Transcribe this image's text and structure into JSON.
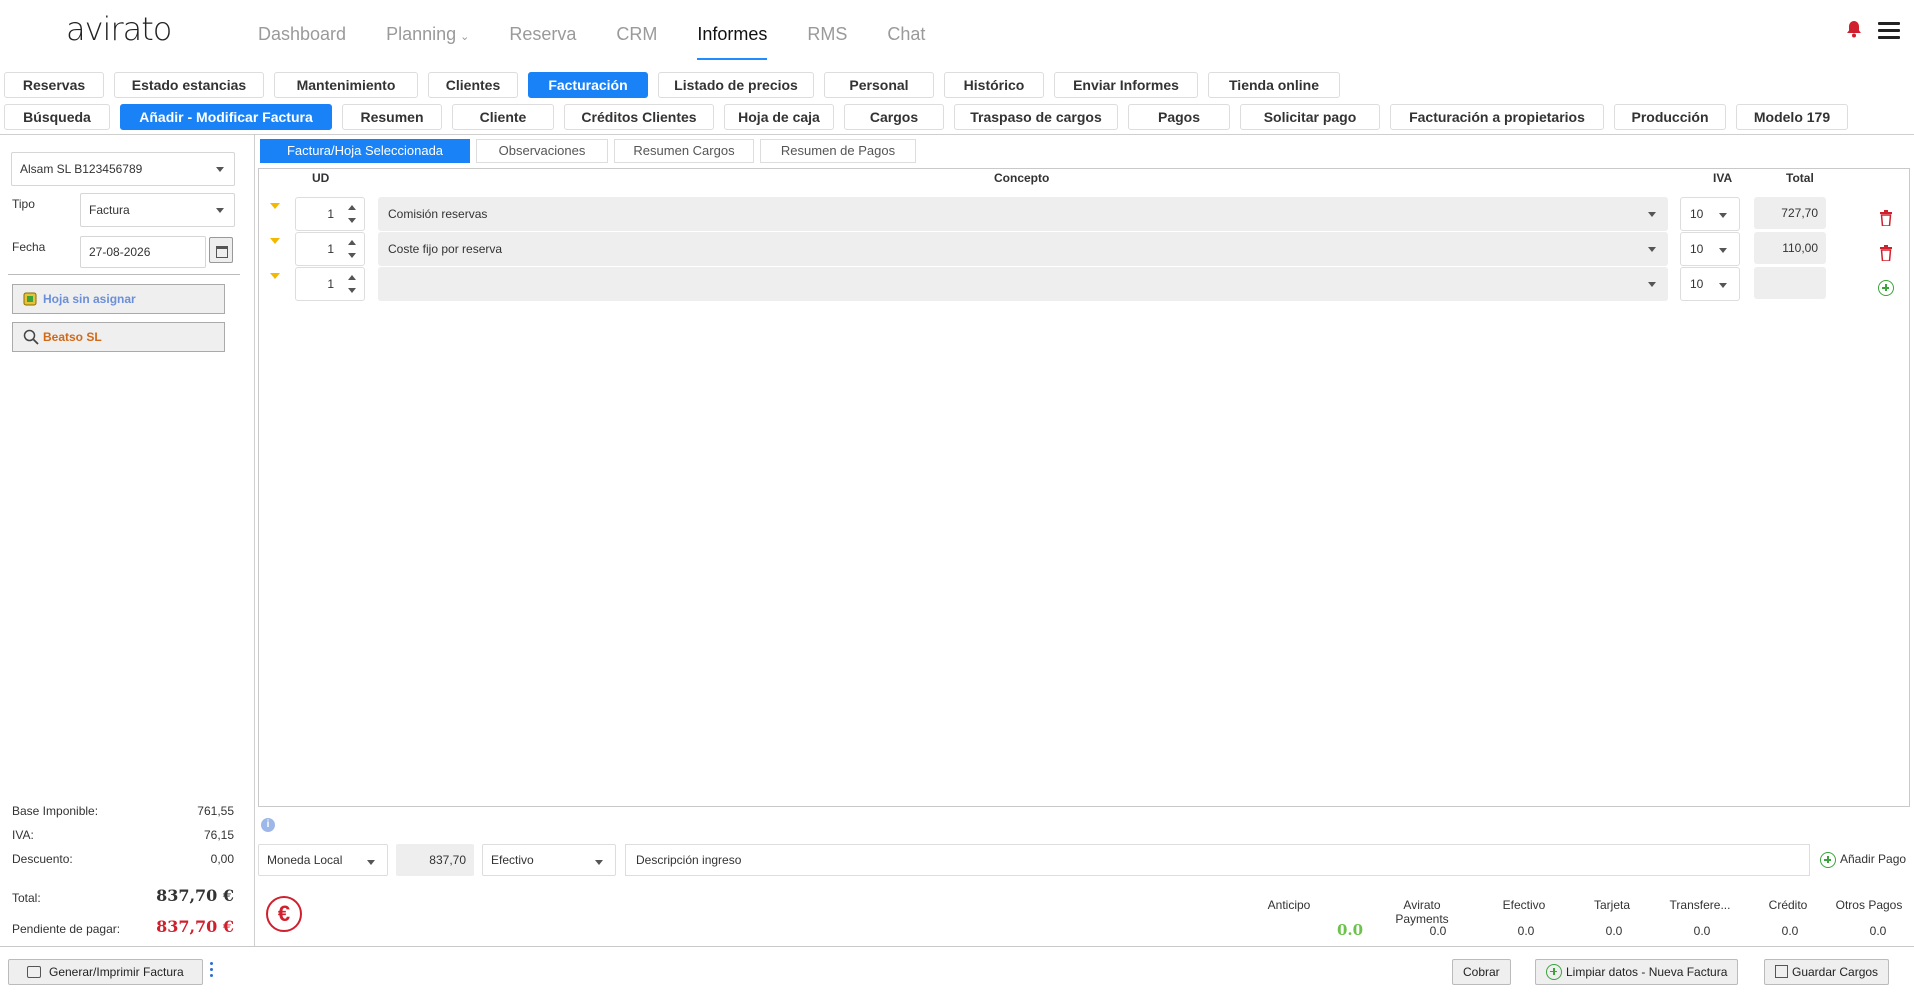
{
  "app": {
    "logo": "avirato"
  },
  "nav": {
    "items": [
      "Dashboard",
      "Planning",
      "Reserva",
      "CRM",
      "Informes",
      "RMS",
      "Chat"
    ],
    "active": "Informes"
  },
  "report_tabs_row1": [
    "Reservas",
    "Estado estancias",
    "Mantenimiento",
    "Clientes",
    "Facturación",
    "Listado de precios",
    "Personal",
    "Histórico",
    "Enviar Informes",
    "Tienda online"
  ],
  "report_tabs_row2": [
    "Búsqueda",
    "Añadir - Modificar Factura",
    "Resumen",
    "Cliente",
    "Créditos Clientes",
    "Hoja de caja",
    "Cargos",
    "Traspaso de cargos",
    "Pagos",
    "Solicitar pago",
    "Facturación a propietarios",
    "Producción",
    "Modelo 179"
  ],
  "left": {
    "company": "Alsam SL B123456789",
    "tipo_label": "Tipo",
    "tipo_value": "Factura",
    "fecha_label": "Fecha",
    "fecha_value": "27-08-2026",
    "hoja_button": "Hoja sin asignar",
    "client_button": "Beatso SL",
    "base_label": "Base Imponible:",
    "base_value": "761,55",
    "iva_label": "IVA:",
    "iva_value": "76,15",
    "descuento_label": "Descuento:",
    "descuento_value": "0,00",
    "total_label": "Total:",
    "total_value": "837,70 €",
    "pendiente_label": "Pendiente de pagar:",
    "pendiente_value": "837,70 €"
  },
  "subtabs": [
    "Factura/Hoja Seleccionada",
    "Observaciones",
    "Resumen Cargos",
    "Resumen de Pagos"
  ],
  "table": {
    "headers": {
      "ud": "UD",
      "concepto": "Concepto",
      "iva": "IVA",
      "total": "Total"
    },
    "rows": [
      {
        "ud": "1",
        "concepto": "Comisión reservas",
        "iva": "10",
        "total": "727,70"
      },
      {
        "ud": "1",
        "concepto": "Coste fijo por reserva",
        "iva": "10",
        "total": "110,00"
      },
      {
        "ud": "1",
        "concepto": "",
        "iva": "10",
        "total": ""
      }
    ]
  },
  "payment": {
    "currency": "Moneda Local",
    "amount": "837,70",
    "method": "Efectivo",
    "description_placeholder": "Descripción ingreso",
    "add_label": "Añadir Pago"
  },
  "pay_summary": {
    "headers": [
      "Anticipo",
      "Avirato Payments",
      "Efectivo",
      "Tarjeta",
      "Transfere...",
      "Crédito",
      "Otros Pagos"
    ],
    "values": [
      "0.0",
      "0.0",
      "0.0",
      "0.0",
      "0.0",
      "0.0",
      "0.0"
    ]
  },
  "footer": {
    "generate": "Generar/Imprimir Factura",
    "cobrar": "Cobrar",
    "limpiar": "Limpiar datos - Nueva Factura",
    "guardar": "Guardar Cargos"
  },
  "colors": {
    "accent": "#1a82f7",
    "danger": "#d0202e",
    "success": "#3aa43a",
    "caret": "#f5b800"
  }
}
